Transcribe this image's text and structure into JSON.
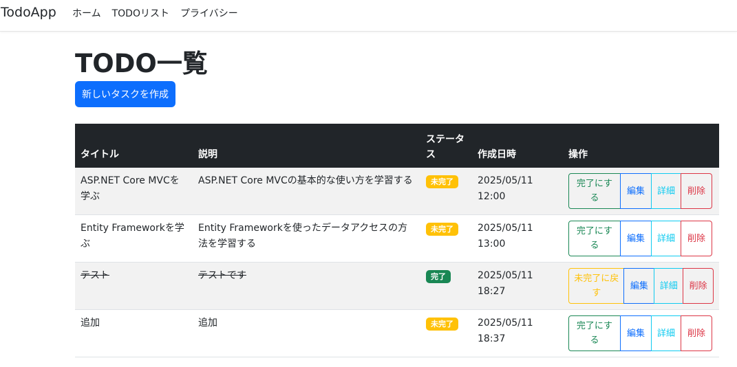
{
  "navbar": {
    "brand": "TodoApp",
    "links": [
      "ホーム",
      "TODOリスト",
      "プライバシー"
    ]
  },
  "page": {
    "title": "TODO一覧",
    "create_button": "新しいタスクを作成"
  },
  "table": {
    "headers": [
      "タイトル",
      "説明",
      "ステータス",
      "作成日時",
      "操作"
    ],
    "rows": [
      {
        "title": "ASP.NET Core MVCを学ぶ",
        "description": "ASP.NET Core MVCの基本的な使い方を学習する",
        "status": "未完了",
        "created": "2025/05/11 12:00",
        "toggle_label": "完了にする"
      },
      {
        "title": "Entity Frameworkを学ぶ",
        "description": "Entity Frameworkを使ったデータアクセスの方法を学習する",
        "status": "未完了",
        "created": "2025/05/11 13:00",
        "toggle_label": "完了にする"
      },
      {
        "title": "テスト",
        "description": "テストです",
        "status": "完了",
        "created": "2025/05/11 18:27",
        "toggle_label": "未完了に戻す"
      },
      {
        "title": "追加",
        "description": "追加",
        "status": "未完了",
        "created": "2025/05/11 18:37",
        "toggle_label": "完了にする"
      }
    ],
    "action_labels": {
      "edit": "編集",
      "detail": "詳細",
      "delete": "削除"
    }
  },
  "colors": {
    "primary": "#0d6efd",
    "success": "#198754",
    "warning": "#ffc107",
    "info": "#0dcaf0",
    "danger": "#dc3545",
    "header_bg": "#212529"
  }
}
